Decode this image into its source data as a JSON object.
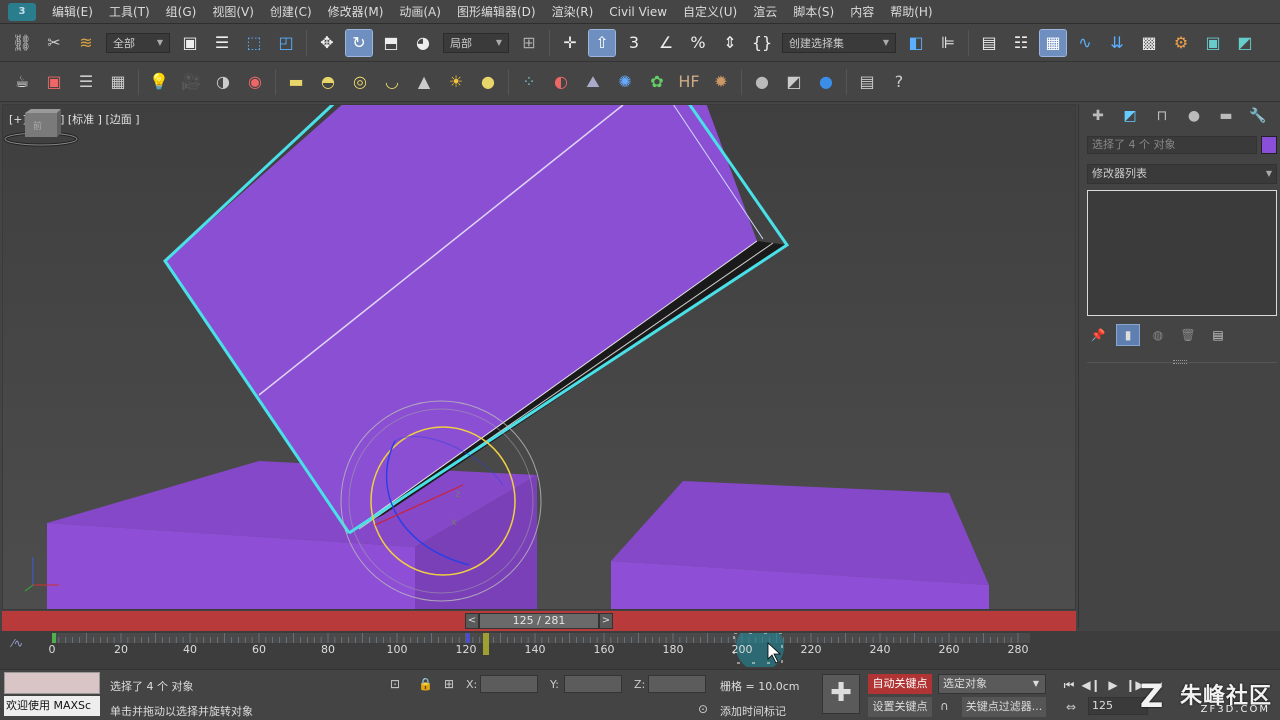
{
  "menu": {
    "items": [
      "编辑(E)",
      "工具(T)",
      "组(G)",
      "视图(V)",
      "创建(C)",
      "修改器(M)",
      "动画(A)",
      "图形编辑器(D)",
      "渲染(R)",
      "Civil View",
      "自定义(U)",
      "渲云",
      "脚本(S)",
      "内容",
      "帮助(H)"
    ]
  },
  "toolbar1": {
    "filter_select": "全部",
    "ref_coord_select": "局部",
    "selection_set": "创建选择集"
  },
  "viewport": {
    "label": "[+] [透视 ] [标准 ] [边面 ]"
  },
  "command_panel": {
    "object_name": "选择了 4 个 对象",
    "modifier_list": "修改器列表",
    "object_color": "#8a4fd8"
  },
  "time_slider": {
    "value": "125 / 281",
    "prev": "<",
    "next": ">"
  },
  "trackbar": {
    "ticks": [
      "0",
      "20",
      "40",
      "60",
      "80",
      "100",
      "120",
      "140",
      "160",
      "180",
      "200",
      "220",
      "240",
      "260",
      "280"
    ]
  },
  "status": {
    "maxscript_line": "欢迎使用 MAXSc",
    "selection_text": "选择了 4 个 对象",
    "prompt_text": "单击并拖动以选择并旋转对象",
    "x_label": "X:",
    "y_label": "Y:",
    "z_label": "Z:",
    "grid_text": "栅格 = 10.0cm",
    "add_time_tag": "添加时间标记",
    "auto_key": "自动关键点",
    "set_key": "设置关键点",
    "selected_dropdown": "选定对象",
    "key_filters": "关键点过滤器...",
    "frame_field": "125"
  },
  "watermark": {
    "main": "朱峰社区",
    "sub": "ZF3D.COM"
  }
}
